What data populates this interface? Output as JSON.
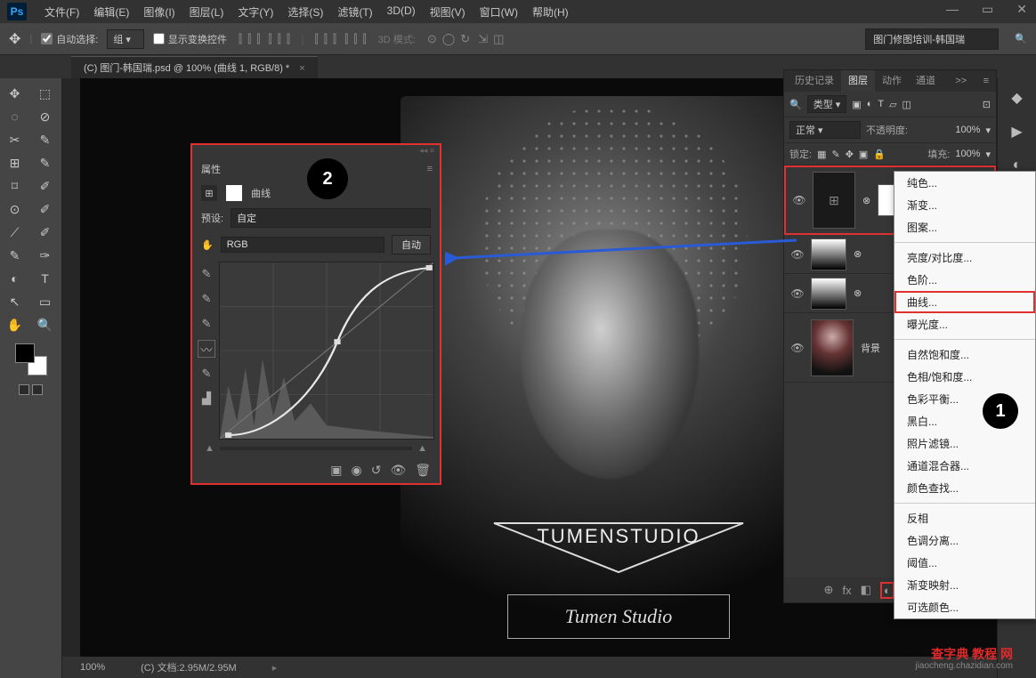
{
  "title": {
    "logo": "Ps"
  },
  "menu": [
    "文件(F)",
    "编辑(E)",
    "图像(I)",
    "图层(L)",
    "文字(Y)",
    "选择(S)",
    "滤镜(T)",
    "3D(D)",
    "视图(V)",
    "窗口(W)",
    "帮助(H)"
  ],
  "win_ctrl": {
    "min": "—",
    "max": "▭",
    "close": "✕"
  },
  "optbar": {
    "auto_select": "自动选择:",
    "group": "组",
    "show_transform": "显示变换控件",
    "mode3d": "3D 模式:",
    "project": "图门修图培训-韩国瑞"
  },
  "doc_tab": {
    "name": "(C) 图门-韩国瑞.psd @ 100% (曲线 1, RGB/8) *",
    "close": "×"
  },
  "tools": [
    "✥",
    "⬚",
    "◌",
    "⊘",
    "✂",
    "✎",
    "⊞",
    "✎",
    "⌑",
    "✐",
    "⊙",
    "✐",
    "⟋",
    "✐",
    "✎",
    "✑",
    "◐",
    "T",
    "↖",
    "▭",
    "✋",
    "🔍"
  ],
  "overlay_logo": "TUMENSTUDIO",
  "overlay_sub": "Tumen Studio",
  "statusbar": {
    "zoom": "100%",
    "doc": "(C) 文档:2.95M/2.95M"
  },
  "panel_tabs": [
    "历史记录",
    "图层",
    "动作",
    "通道"
  ],
  "panel_more": ">>",
  "filter_row": {
    "kind": "类型"
  },
  "blend_row": {
    "mode": "正常",
    "opacity_lbl": "不透明度:",
    "opacity": "100%"
  },
  "lock_row": {
    "lock_lbl": "锁定:",
    "fill_lbl": "填充:",
    "fill": "100%"
  },
  "layers": [
    {
      "name": "",
      "kind": "curves"
    },
    {
      "name": "",
      "kind": "levels"
    },
    {
      "name": "",
      "kind": "levels"
    },
    {
      "name": "背景",
      "kind": "image"
    }
  ],
  "panel_footer_icons": [
    "⊕",
    "fx",
    "◧",
    "◐",
    "▣",
    "⊡",
    "🗑"
  ],
  "adj_menu": {
    "g1": [
      "纯色...",
      "渐变...",
      "图案..."
    ],
    "g2": [
      "亮度/对比度...",
      "色阶...",
      "曲线...",
      "曝光度..."
    ],
    "g3": [
      "自然饱和度...",
      "色相/饱和度...",
      "色彩平衡...",
      "黑白...",
      "照片滤镜...",
      "通道混合器...",
      "颜色查找..."
    ],
    "g4": [
      "反相",
      "色调分离...",
      "阈值...",
      "渐变映射...",
      "可选颜色..."
    ]
  },
  "adj_hi": "曲线...",
  "badges": {
    "b1": "1",
    "b2": "2"
  },
  "props": {
    "title": "属性",
    "type_label": "曲线",
    "preset_lbl": "预设:",
    "preset_val": "自定",
    "channel": "RGB",
    "auto": "自动"
  },
  "watermark": {
    "main": "查字典 教程 网",
    "sub": "jiaocheng.chazidian.com"
  }
}
